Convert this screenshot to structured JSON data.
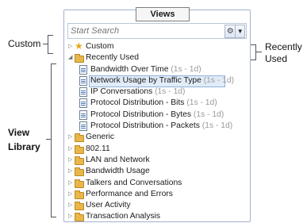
{
  "annotations": {
    "custom": "Custom",
    "recently_used": "Recently Used",
    "view_library": "View Library"
  },
  "panel": {
    "title": "Views",
    "search_placeholder": "Start Search"
  },
  "tree": {
    "custom": "Custom",
    "recently_used": "Recently Used",
    "recent_items": [
      {
        "name": "Bandwidth Over Time",
        "range": "(1s - 1d)"
      },
      {
        "name": "Network Usage by Traffic Type",
        "range": "(1s - 1d)",
        "selected": true
      },
      {
        "name": "IP Conversations",
        "range": "(1s - 1d)"
      },
      {
        "name": "Protocol Distribution - Bits",
        "range": "(1s - 1d)"
      },
      {
        "name": "Protocol Distribution - Bytes",
        "range": "(1s - 1d)"
      },
      {
        "name": "Protocol Distribution - Packets",
        "range": "(1s - 1d)"
      }
    ],
    "library": [
      "Generic",
      "802.11",
      "LAN and Network",
      "Bandwidth Usage",
      "Talkers and Conversations",
      "Performance and Errors",
      "User Activity",
      "Transaction Analysis"
    ]
  }
}
